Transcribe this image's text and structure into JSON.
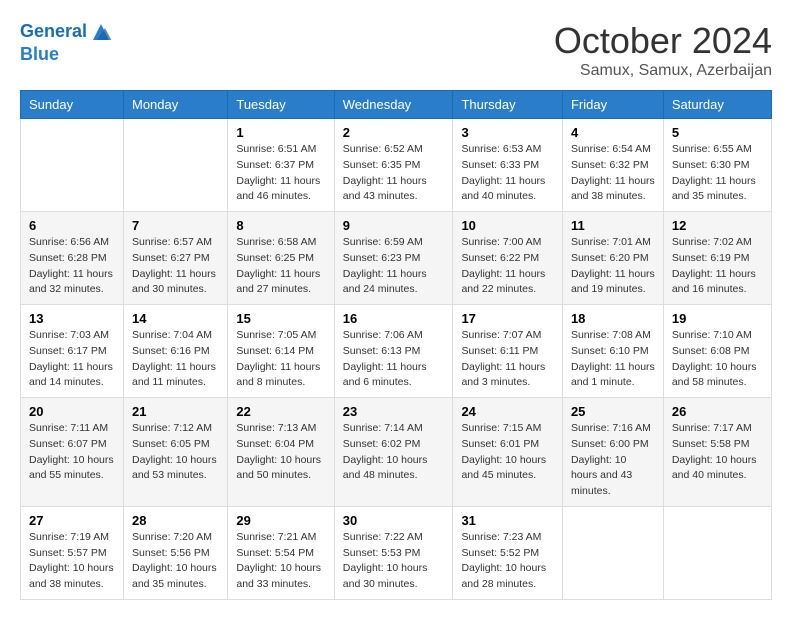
{
  "logo": {
    "line1": "General",
    "line2": "Blue"
  },
  "title": "October 2024",
  "subtitle": "Samux, Samux, Azerbaijan",
  "days_of_week": [
    "Sunday",
    "Monday",
    "Tuesday",
    "Wednesday",
    "Thursday",
    "Friday",
    "Saturday"
  ],
  "weeks": [
    [
      null,
      null,
      {
        "num": "1",
        "sunrise": "Sunrise: 6:51 AM",
        "sunset": "Sunset: 6:37 PM",
        "daylight": "Daylight: 11 hours and 46 minutes."
      },
      {
        "num": "2",
        "sunrise": "Sunrise: 6:52 AM",
        "sunset": "Sunset: 6:35 PM",
        "daylight": "Daylight: 11 hours and 43 minutes."
      },
      {
        "num": "3",
        "sunrise": "Sunrise: 6:53 AM",
        "sunset": "Sunset: 6:33 PM",
        "daylight": "Daylight: 11 hours and 40 minutes."
      },
      {
        "num": "4",
        "sunrise": "Sunrise: 6:54 AM",
        "sunset": "Sunset: 6:32 PM",
        "daylight": "Daylight: 11 hours and 38 minutes."
      },
      {
        "num": "5",
        "sunrise": "Sunrise: 6:55 AM",
        "sunset": "Sunset: 6:30 PM",
        "daylight": "Daylight: 11 hours and 35 minutes."
      }
    ],
    [
      {
        "num": "6",
        "sunrise": "Sunrise: 6:56 AM",
        "sunset": "Sunset: 6:28 PM",
        "daylight": "Daylight: 11 hours and 32 minutes."
      },
      {
        "num": "7",
        "sunrise": "Sunrise: 6:57 AM",
        "sunset": "Sunset: 6:27 PM",
        "daylight": "Daylight: 11 hours and 30 minutes."
      },
      {
        "num": "8",
        "sunrise": "Sunrise: 6:58 AM",
        "sunset": "Sunset: 6:25 PM",
        "daylight": "Daylight: 11 hours and 27 minutes."
      },
      {
        "num": "9",
        "sunrise": "Sunrise: 6:59 AM",
        "sunset": "Sunset: 6:23 PM",
        "daylight": "Daylight: 11 hours and 24 minutes."
      },
      {
        "num": "10",
        "sunrise": "Sunrise: 7:00 AM",
        "sunset": "Sunset: 6:22 PM",
        "daylight": "Daylight: 11 hours and 22 minutes."
      },
      {
        "num": "11",
        "sunrise": "Sunrise: 7:01 AM",
        "sunset": "Sunset: 6:20 PM",
        "daylight": "Daylight: 11 hours and 19 minutes."
      },
      {
        "num": "12",
        "sunrise": "Sunrise: 7:02 AM",
        "sunset": "Sunset: 6:19 PM",
        "daylight": "Daylight: 11 hours and 16 minutes."
      }
    ],
    [
      {
        "num": "13",
        "sunrise": "Sunrise: 7:03 AM",
        "sunset": "Sunset: 6:17 PM",
        "daylight": "Daylight: 11 hours and 14 minutes."
      },
      {
        "num": "14",
        "sunrise": "Sunrise: 7:04 AM",
        "sunset": "Sunset: 6:16 PM",
        "daylight": "Daylight: 11 hours and 11 minutes."
      },
      {
        "num": "15",
        "sunrise": "Sunrise: 7:05 AM",
        "sunset": "Sunset: 6:14 PM",
        "daylight": "Daylight: 11 hours and 8 minutes."
      },
      {
        "num": "16",
        "sunrise": "Sunrise: 7:06 AM",
        "sunset": "Sunset: 6:13 PM",
        "daylight": "Daylight: 11 hours and 6 minutes."
      },
      {
        "num": "17",
        "sunrise": "Sunrise: 7:07 AM",
        "sunset": "Sunset: 6:11 PM",
        "daylight": "Daylight: 11 hours and 3 minutes."
      },
      {
        "num": "18",
        "sunrise": "Sunrise: 7:08 AM",
        "sunset": "Sunset: 6:10 PM",
        "daylight": "Daylight: 11 hours and 1 minute."
      },
      {
        "num": "19",
        "sunrise": "Sunrise: 7:10 AM",
        "sunset": "Sunset: 6:08 PM",
        "daylight": "Daylight: 10 hours and 58 minutes."
      }
    ],
    [
      {
        "num": "20",
        "sunrise": "Sunrise: 7:11 AM",
        "sunset": "Sunset: 6:07 PM",
        "daylight": "Daylight: 10 hours and 55 minutes."
      },
      {
        "num": "21",
        "sunrise": "Sunrise: 7:12 AM",
        "sunset": "Sunset: 6:05 PM",
        "daylight": "Daylight: 10 hours and 53 minutes."
      },
      {
        "num": "22",
        "sunrise": "Sunrise: 7:13 AM",
        "sunset": "Sunset: 6:04 PM",
        "daylight": "Daylight: 10 hours and 50 minutes."
      },
      {
        "num": "23",
        "sunrise": "Sunrise: 7:14 AM",
        "sunset": "Sunset: 6:02 PM",
        "daylight": "Daylight: 10 hours and 48 minutes."
      },
      {
        "num": "24",
        "sunrise": "Sunrise: 7:15 AM",
        "sunset": "Sunset: 6:01 PM",
        "daylight": "Daylight: 10 hours and 45 minutes."
      },
      {
        "num": "25",
        "sunrise": "Sunrise: 7:16 AM",
        "sunset": "Sunset: 6:00 PM",
        "daylight": "Daylight: 10 hours and 43 minutes."
      },
      {
        "num": "26",
        "sunrise": "Sunrise: 7:17 AM",
        "sunset": "Sunset: 5:58 PM",
        "daylight": "Daylight: 10 hours and 40 minutes."
      }
    ],
    [
      {
        "num": "27",
        "sunrise": "Sunrise: 7:19 AM",
        "sunset": "Sunset: 5:57 PM",
        "daylight": "Daylight: 10 hours and 38 minutes."
      },
      {
        "num": "28",
        "sunrise": "Sunrise: 7:20 AM",
        "sunset": "Sunset: 5:56 PM",
        "daylight": "Daylight: 10 hours and 35 minutes."
      },
      {
        "num": "29",
        "sunrise": "Sunrise: 7:21 AM",
        "sunset": "Sunset: 5:54 PM",
        "daylight": "Daylight: 10 hours and 33 minutes."
      },
      {
        "num": "30",
        "sunrise": "Sunrise: 7:22 AM",
        "sunset": "Sunset: 5:53 PM",
        "daylight": "Daylight: 10 hours and 30 minutes."
      },
      {
        "num": "31",
        "sunrise": "Sunrise: 7:23 AM",
        "sunset": "Sunset: 5:52 PM",
        "daylight": "Daylight: 10 hours and 28 minutes."
      },
      null,
      null
    ]
  ]
}
